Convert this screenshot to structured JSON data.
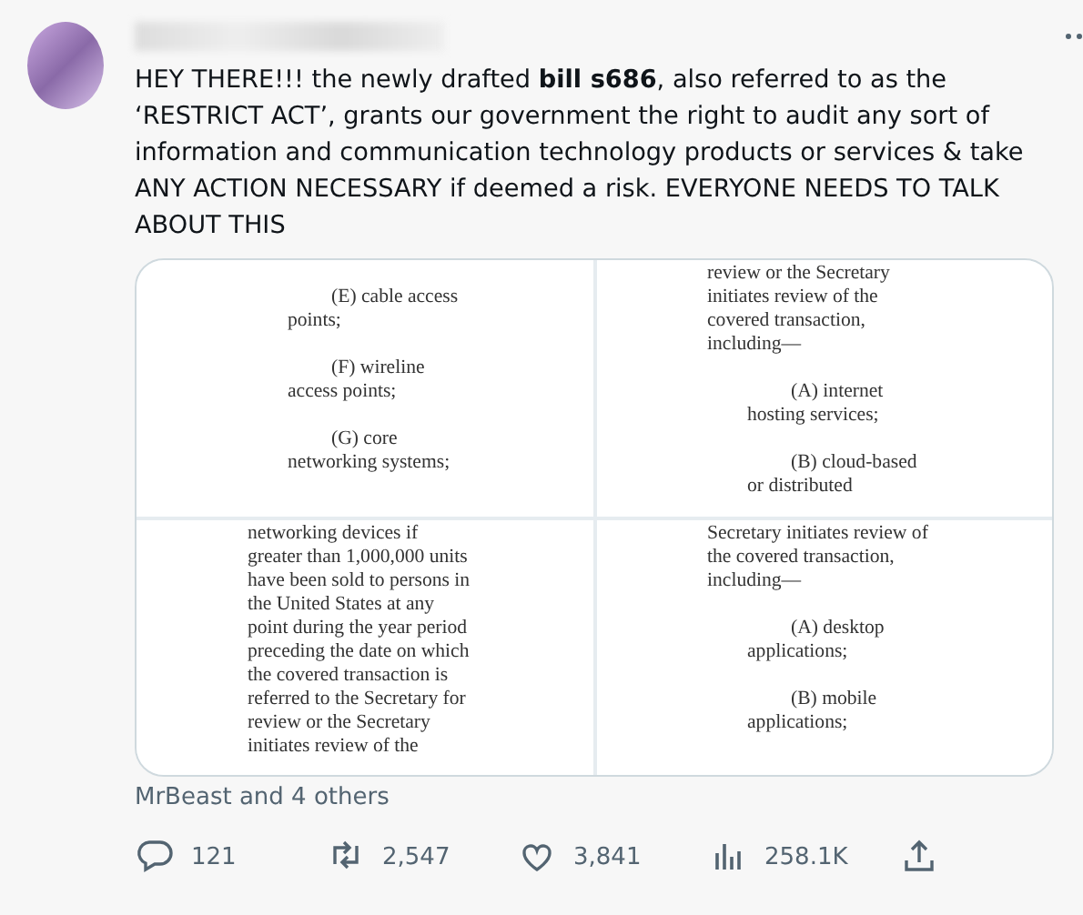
{
  "post": {
    "text": "HEY THERE!!! the newly drafted **bill s686**, also referred to as the ‘RESTRICT ACT’, grants our government the right to audit any sort of information and communication technology products or services & take ANY ACTION NECESSARY if deemed a risk. EVERYONE NEEDS TO TALK ABOUT THIS",
    "media": [
      {
        "lines": [
          {
            "kind": "item",
            "text": "(E) cable access"
          },
          {
            "kind": "cont",
            "text": "points;"
          },
          {
            "kind": "item",
            "text": "(F) wireline"
          },
          {
            "kind": "cont",
            "text": "access points;"
          },
          {
            "kind": "item",
            "text": "(G) core"
          },
          {
            "kind": "cont",
            "text": "networking systems;"
          }
        ]
      },
      {
        "lines": [
          {
            "kind": "body",
            "text": "review or the Secretary"
          },
          {
            "kind": "body",
            "text": "initiates review of the"
          },
          {
            "kind": "body",
            "text": "covered transaction,"
          },
          {
            "kind": "body",
            "text": "including—"
          },
          {
            "kind": "item",
            "text": "(A) internet"
          },
          {
            "kind": "cont",
            "text": "hosting services;"
          },
          {
            "kind": "item",
            "text": "(B) cloud-based"
          },
          {
            "kind": "cont",
            "text": "or distributed"
          }
        ]
      },
      {
        "lines": [
          {
            "kind": "body",
            "text": "networking devices if"
          },
          {
            "kind": "body",
            "text": "greater than 1,000,000 units"
          },
          {
            "kind": "body",
            "text": "have been sold to persons in"
          },
          {
            "kind": "body",
            "text": "the United States at any"
          },
          {
            "kind": "body",
            "text": "point during the year period"
          },
          {
            "kind": "body",
            "text": "preceding the date on which"
          },
          {
            "kind": "body",
            "text": "the covered transaction is"
          },
          {
            "kind": "body",
            "text": "referred to the Secretary for"
          },
          {
            "kind": "body",
            "text": "review or the Secretary"
          },
          {
            "kind": "body",
            "text": "initiates review of the"
          }
        ]
      },
      {
        "lines": [
          {
            "kind": "body",
            "text": "Secretary initiates review of"
          },
          {
            "kind": "body",
            "text": "the covered transaction,"
          },
          {
            "kind": "body",
            "text": "including—"
          },
          {
            "kind": "item",
            "text": "(A) desktop"
          },
          {
            "kind": "cont",
            "text": "applications;"
          },
          {
            "kind": "item",
            "text": "(B) mobile"
          },
          {
            "kind": "cont",
            "text": "applications;"
          }
        ]
      }
    ],
    "liked_by": "MrBeast and 4 others",
    "actions": [
      {
        "kind": "reply",
        "count": "121"
      },
      {
        "kind": "retweet",
        "count": "2,547"
      },
      {
        "kind": "like",
        "count": "3,841"
      },
      {
        "kind": "views",
        "count": "258.1K"
      },
      {
        "kind": "share"
      }
    ]
  }
}
